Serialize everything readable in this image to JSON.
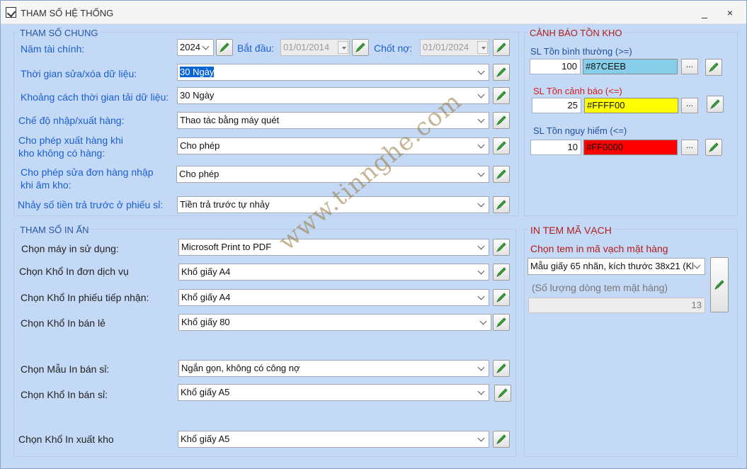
{
  "window": {
    "title": "THAM SỐ HỆ THỐNG",
    "minimize": "_",
    "close": "×"
  },
  "general": {
    "title": "THAM SỐ CHUNG",
    "fiscal_year_label": "Năm tài chính:",
    "fiscal_year_value": "2024",
    "start_label": "Bắt đầu:",
    "start_value": "01/01/2014",
    "closing_label": "Chốt nợ:",
    "closing_value": "01/01/2024",
    "edit_time_label": "Thời gian sửa/xóa dữ liệu:",
    "edit_time_value": "30 Ngày",
    "load_interval_label": "Khoảng cách thời gian tải dữ liệu:",
    "load_interval_value": "30 Ngày",
    "io_mode_label": "Chế độ nhập/xuất hàng:",
    "io_mode_value": "Thao tác bằng máy quét",
    "allow_export_label_1": "Cho phép xuất hàng khi",
    "allow_export_label_2": "kho không có hàng:",
    "allow_export_value": "Cho phép",
    "allow_edit_label_1": "Cho phép sửa đơn hàng nhập",
    "allow_edit_label_2": "khi âm kho:",
    "allow_edit_value": "Cho phép",
    "prepaid_label": "Nhảy số tiền trả trước ở phiếu sỉ:",
    "prepaid_value": "Tiền trả trước tự nhảy"
  },
  "print": {
    "title": "THAM SỐ IN ẤN",
    "rows": [
      {
        "label": "Chọn máy in sử dụng:",
        "value": "Microsoft Print to PDF"
      },
      {
        "label": "Chọn Khổ In đơn dịch vụ",
        "value": "Khổ giấy A4"
      },
      {
        "label": "Chọn Khổ In phiếu tiếp nhận:",
        "value": "Khổ giấy A4"
      },
      {
        "label": "Chọn Khổ In bán lẻ",
        "value": "Khổ giấy 80"
      },
      {
        "label": "Chọn Mẫu In bán sỉ:",
        "value": "Ngắn gọn, không có công nợ"
      },
      {
        "label": "Chọn Khổ In bán sỉ:",
        "value": "Khổ giấy A5"
      },
      {
        "label": "Chọn Khổ In xuất kho",
        "value": "Khổ giấy A5"
      }
    ]
  },
  "stock_alert": {
    "title": "CẢNH BÁO TỒN KHO",
    "normal_label": "SL Tồn bình thường (>=)",
    "normal_value": "100",
    "normal_color": "#87CEEB",
    "warning_label": "SL Tồn cảnh báo (<=)",
    "warning_value": "25",
    "warning_color": "#FFFF00",
    "danger_label": "SL Tồn nguy hiểm (<=)",
    "danger_value": "10",
    "danger_color": "#FF0000",
    "browse_label": "..."
  },
  "barcode": {
    "title": "IN TEM MÃ VẠCH",
    "select_label": "Chọn tem in mã vạch mặt hàng",
    "template_value": "Mẫu giấy 65 nhãn, kích thước 38x21 (Kh",
    "lines_label": "(Số lượng dòng tem mặt hàng)",
    "lines_value": "13"
  },
  "watermark": "www.tinnghe.com"
}
